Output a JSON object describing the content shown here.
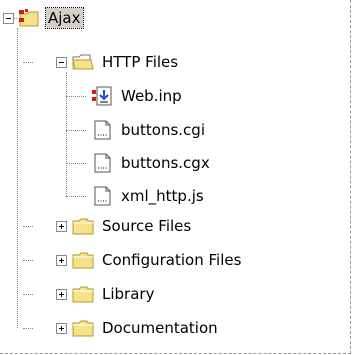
{
  "tree": {
    "root": {
      "label": "Ajax",
      "icon": "project-icon",
      "state": "expanded"
    },
    "http_files": {
      "label": "HTTP Files",
      "icon": "open-folder-icon",
      "state": "expanded"
    },
    "web_inp": {
      "label": "Web.inp",
      "icon": "download-file-icon"
    },
    "buttons_cgi": {
      "label": "buttons.cgi",
      "icon": "file-icon"
    },
    "buttons_cgx": {
      "label": "buttons.cgx",
      "icon": "file-icon"
    },
    "xml_http_js": {
      "label": "xml_http.js",
      "icon": "file-icon"
    },
    "source_files": {
      "label": "Source Files",
      "icon": "folder-icon",
      "state": "collapsed"
    },
    "configuration_files": {
      "label": "Configuration Files",
      "icon": "folder-icon",
      "state": "collapsed"
    },
    "library": {
      "label": "Library",
      "icon": "folder-icon",
      "state": "collapsed"
    },
    "documentation": {
      "label": "Documentation",
      "icon": "folder-icon",
      "state": "collapsed"
    }
  },
  "colors": {
    "folder_fill": "#f6e28a",
    "folder_stroke": "#b59a2e",
    "project_red": "#d21a1a",
    "file_stroke": "#555555",
    "download_blue": "#1f4fd0"
  }
}
